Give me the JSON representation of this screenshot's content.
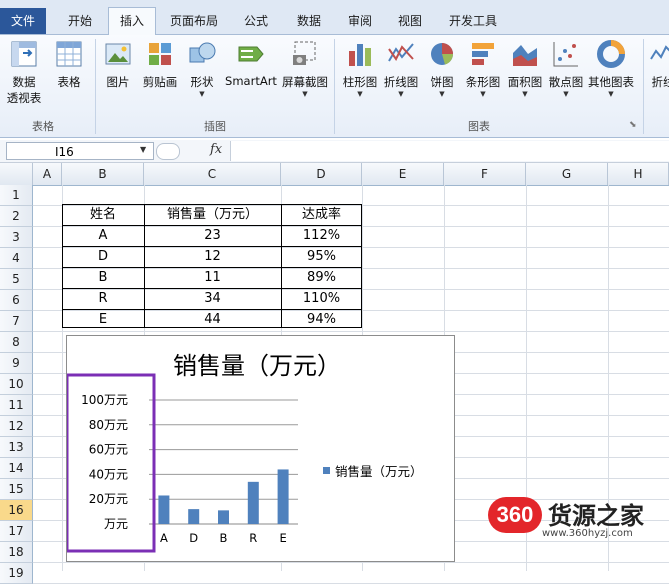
{
  "ribbon": {
    "tabs": [
      {
        "label": "文件"
      },
      {
        "label": "开始"
      },
      {
        "label": "插入"
      },
      {
        "label": "页面布局"
      },
      {
        "label": "公式"
      },
      {
        "label": "数据"
      },
      {
        "label": "审阅"
      },
      {
        "label": "视图"
      },
      {
        "label": "开发工具"
      }
    ],
    "buttons": {
      "pivot": "数据\n透视表",
      "pivot_l1": "数据",
      "pivot_l2": "透视表",
      "table": "表格",
      "picture": "图片",
      "clipart": "剪贴画",
      "shapes": "形状",
      "smartart": "SmartArt",
      "screenshot": "屏幕截图",
      "column": "柱形图",
      "line": "折线图",
      "pie": "饼图",
      "bar": "条形图",
      "area": "面积图",
      "scatter": "散点图",
      "other": "其他图表",
      "sparkline": "折线"
    },
    "groups": {
      "tables": "表格",
      "illustrations": "插图",
      "charts": "图表"
    }
  },
  "formula_bar": {
    "name_box": "I16",
    "fx": "fx",
    "formula": ""
  },
  "grid": {
    "columns": [
      "A",
      "B",
      "C",
      "D",
      "E",
      "F",
      "G",
      "H"
    ],
    "rows": [
      "1",
      "2",
      "3",
      "4",
      "5",
      "6",
      "7",
      "8",
      "9",
      "10",
      "11",
      "12",
      "13",
      "14",
      "15",
      "16",
      "17",
      "18",
      "19"
    ]
  },
  "table": {
    "headers": [
      "姓名",
      "销售量（万元）",
      "达成率"
    ],
    "rows": [
      [
        "A",
        "23",
        "112%"
      ],
      [
        "D",
        "12",
        "95%"
      ],
      [
        "B",
        "11",
        "89%"
      ],
      [
        "R",
        "34",
        "110%"
      ],
      [
        "E",
        "44",
        "94%"
      ]
    ]
  },
  "chart_data": {
    "type": "bar",
    "title": "销售量（万元）",
    "categories": [
      "A",
      "D",
      "B",
      "R",
      "E"
    ],
    "series": [
      {
        "name": "销售量（万元）",
        "values": [
          23,
          12,
          11,
          34,
          44
        ]
      }
    ],
    "ylim": [
      0,
      100
    ],
    "y_tick_labels": [
      "万元",
      "20万元",
      "40万元",
      "60万元",
      "80万元",
      "100万元"
    ],
    "grid": true,
    "legend": "right",
    "bar_color": "#4f81bd",
    "highlight_color": "#7b2fb5"
  },
  "watermark": {
    "logo": "360",
    "text": "货源之家",
    "url": "www.360hyzj.com"
  },
  "colors": {
    "file_tab": "#2b579a",
    "accent": "#4f81bd"
  }
}
